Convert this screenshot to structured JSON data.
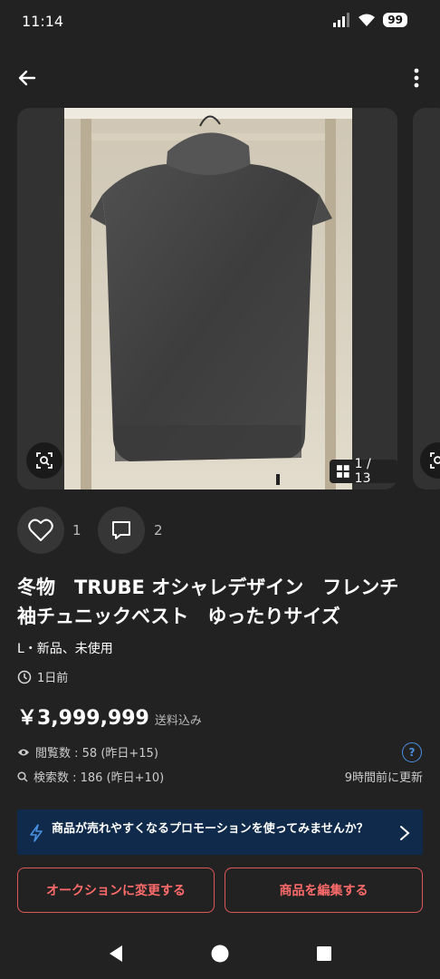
{
  "status_bar": {
    "time": "11:14",
    "battery": "99"
  },
  "gallery": {
    "counter": "1 / 13"
  },
  "actions": {
    "likes": "1",
    "comments": "2"
  },
  "item": {
    "title": "冬物　TRUBE オシャレデザイン　フレンチ袖チュニックベスト　ゆったりサイズ",
    "condition": "L・新品、未使用",
    "posted": "1日前",
    "price": "￥3,999,999",
    "shipping": "送料込み"
  },
  "stats": {
    "views": "閲覧数 : 58 (昨日+15)",
    "searches": "検索数 : 186 (昨日+10)",
    "updated": "9時間前に更新",
    "help": "?"
  },
  "promo": {
    "text": "商品が売れやすくなるプロモーションを使ってみませんか？"
  },
  "buttons": {
    "auction": "オークションに変更する",
    "edit": "商品を編集する"
  },
  "colors": {
    "background": "#222222",
    "accent_red": "#e0575a",
    "promo_bg": "#0f2a4a",
    "help_blue": "#4a90e2"
  },
  "icons": {
    "back": "arrow-left-icon",
    "more": "more-vertical-icon",
    "lens": "image-search-icon",
    "grid": "grid-icon",
    "like": "heart-icon",
    "comment": "comment-icon",
    "clock": "clock-icon",
    "views": "eye-icon",
    "search": "search-icon",
    "promo": "lightning-icon",
    "promo_chevron": "chevron-right-icon"
  }
}
